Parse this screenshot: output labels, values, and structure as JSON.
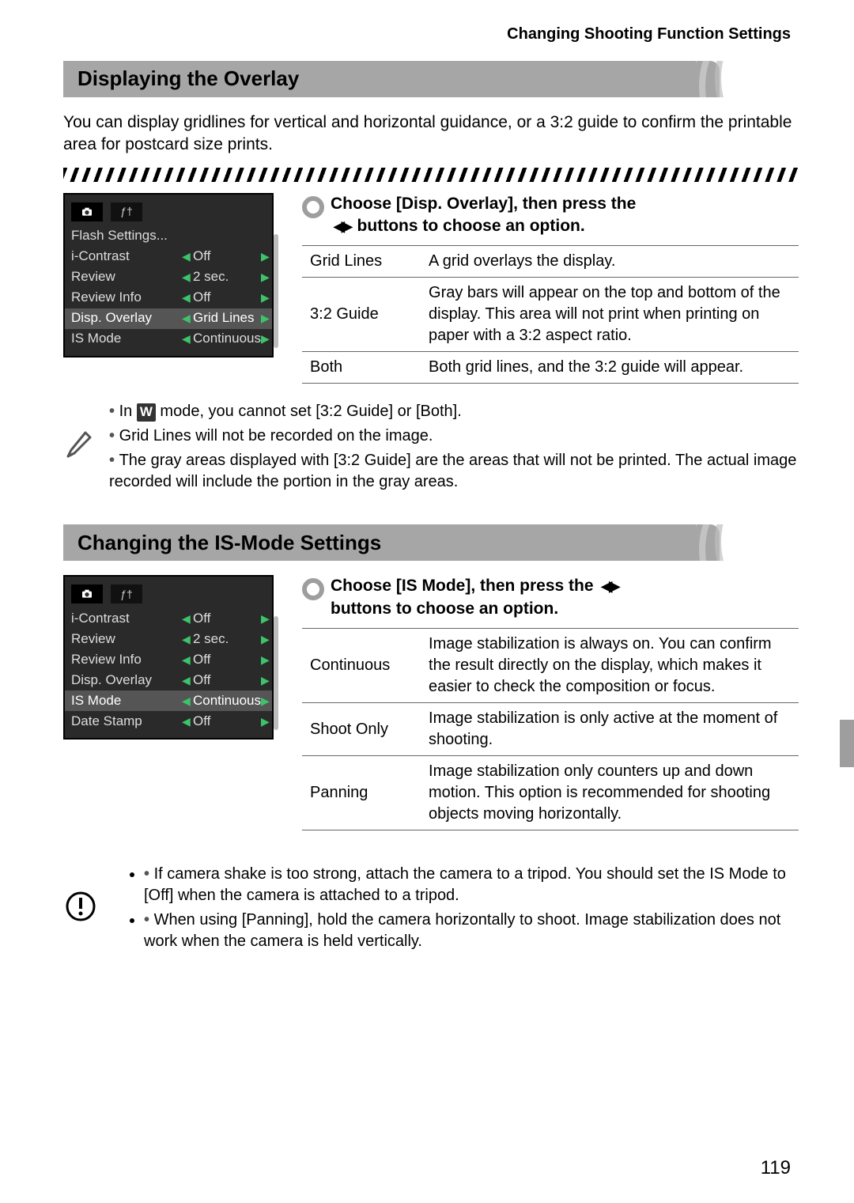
{
  "header": "Changing Shooting Function Settings",
  "section1": {
    "title": "Displaying the Overlay",
    "intro": "You can display gridlines for vertical and horizontal guidance, or a 3:2 guide to confirm the printable area for postcard size prints.",
    "lcd": {
      "rows": [
        {
          "label": "Flash Settings...",
          "val": "",
          "selected": false,
          "hasArrows": false
        },
        {
          "label": "i-Contrast",
          "val": "Off",
          "selected": false,
          "hasArrows": true
        },
        {
          "label": "Review",
          "val": "2 sec.",
          "selected": false,
          "hasArrows": true
        },
        {
          "label": "Review Info",
          "val": "Off",
          "selected": false,
          "hasArrows": true
        },
        {
          "label": "Disp. Overlay",
          "val": "Grid Lines",
          "selected": true,
          "hasArrows": true
        },
        {
          "label": "IS Mode",
          "val": "Continuous",
          "selected": false,
          "hasArrows": true
        }
      ]
    },
    "lead_a": "Choose [Disp. Overlay], then press the",
    "lead_b": "buttons to choose an option.",
    "options": [
      {
        "k": "Grid Lines",
        "v": "A grid overlays the display."
      },
      {
        "k": "3:2 Guide",
        "v": "Gray bars will appear on the top and bottom of the display. This area will not print when printing on paper with a 3:2 aspect ratio."
      },
      {
        "k": "Both",
        "v": "Both grid lines, and the 3:2 guide will appear."
      }
    ],
    "notes": [
      "In  W  mode, you cannot set [3:2 Guide] or [Both].",
      "Grid Lines will not be recorded on the image.",
      "The gray areas displayed with [3:2 Guide] are the areas that will not be printed. The actual image recorded will include the portion in the gray areas."
    ]
  },
  "section2": {
    "title": "Changing the IS-Mode Settings",
    "lcd": {
      "rows": [
        {
          "label": "i-Contrast",
          "val": "Off",
          "selected": false,
          "hasArrows": true
        },
        {
          "label": "Review",
          "val": "2 sec.",
          "selected": false,
          "hasArrows": true
        },
        {
          "label": "Review Info",
          "val": "Off",
          "selected": false,
          "hasArrows": true
        },
        {
          "label": "Disp. Overlay",
          "val": "Off",
          "selected": false,
          "hasArrows": true
        },
        {
          "label": "IS Mode",
          "val": "Continuous",
          "selected": true,
          "hasArrows": true
        },
        {
          "label": "Date Stamp",
          "val": "Off",
          "selected": false,
          "hasArrows": true
        }
      ]
    },
    "lead_a": "Choose [IS Mode], then press the",
    "lead_b": "buttons to choose an option.",
    "options": [
      {
        "k": "Continuous",
        "v": "Image stabilization is always on. You can confirm the result directly on the display, which makes it easier to check the composition or focus."
      },
      {
        "k": "Shoot Only",
        "v": "Image stabilization is only active at the moment of shooting."
      },
      {
        "k": "Panning",
        "v": "Image stabilization only counters up and down motion. This option is recommended for shooting objects moving horizontally."
      }
    ],
    "alerts": [
      "If camera shake is too strong, attach the camera to a tripod. You should set the IS Mode to [Off] when the camera is attached to a tripod.",
      "When using [Panning], hold the camera horizontally to shoot. Image stabilization does not work when the camera is held vertically."
    ]
  },
  "page_number": "119"
}
